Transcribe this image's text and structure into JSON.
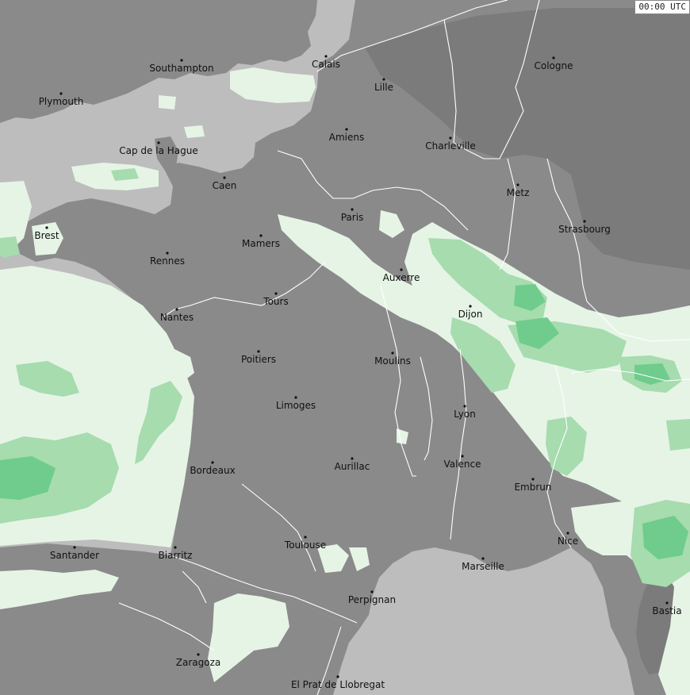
{
  "timestamp": "00:00 UTC",
  "colors": {
    "sea": "#bdbdbd",
    "land": "#8a8a8a",
    "land_east": "#7b7b7b",
    "border": "#ffffff",
    "precip_light": "#e6f4e6",
    "precip_medium": "#a6dcae",
    "precip_heavy": "#6fcc8c"
  },
  "cities": [
    {
      "id": "southampton",
      "name": "Southampton"
    },
    {
      "id": "calais",
      "name": "Calais"
    },
    {
      "id": "cologne",
      "name": "Cologne"
    },
    {
      "id": "plymouth",
      "name": "Plymouth"
    },
    {
      "id": "lille",
      "name": "Lille"
    },
    {
      "id": "amiens",
      "name": "Amiens"
    },
    {
      "id": "charleville",
      "name": "Charleville"
    },
    {
      "id": "cap-de-la-hague",
      "name": "Cap de la Hague"
    },
    {
      "id": "caen",
      "name": "Caen"
    },
    {
      "id": "metz",
      "name": "Metz"
    },
    {
      "id": "paris",
      "name": "Paris"
    },
    {
      "id": "strasbourg",
      "name": "Strasbourg"
    },
    {
      "id": "brest",
      "name": "Brest"
    },
    {
      "id": "mamers",
      "name": "Mamers"
    },
    {
      "id": "rennes",
      "name": "Rennes"
    },
    {
      "id": "auxerre",
      "name": "Auxerre"
    },
    {
      "id": "tours",
      "name": "Tours"
    },
    {
      "id": "dijon",
      "name": "Dijon"
    },
    {
      "id": "nantes",
      "name": "Nantes"
    },
    {
      "id": "poitiers",
      "name": "Poitiers"
    },
    {
      "id": "moulins",
      "name": "Moulins"
    },
    {
      "id": "limoges",
      "name": "Limoges"
    },
    {
      "id": "lyon",
      "name": "Lyon"
    },
    {
      "id": "valence",
      "name": "Valence"
    },
    {
      "id": "bordeaux",
      "name": "Bordeaux"
    },
    {
      "id": "aurillac",
      "name": "Aurillac"
    },
    {
      "id": "embrun",
      "name": "Embrun"
    },
    {
      "id": "nice",
      "name": "Nice"
    },
    {
      "id": "santander",
      "name": "Santander"
    },
    {
      "id": "biarritz",
      "name": "Biarritz"
    },
    {
      "id": "toulouse",
      "name": "Toulouse"
    },
    {
      "id": "marseille",
      "name": "Marseille"
    },
    {
      "id": "perpignan",
      "name": "Perpignan"
    },
    {
      "id": "bastia",
      "name": "Bastia"
    },
    {
      "id": "zaragoza",
      "name": "Zaragoza"
    },
    {
      "id": "el-prat-de-llobregat",
      "name": "El Prat de Llobregat"
    }
  ]
}
